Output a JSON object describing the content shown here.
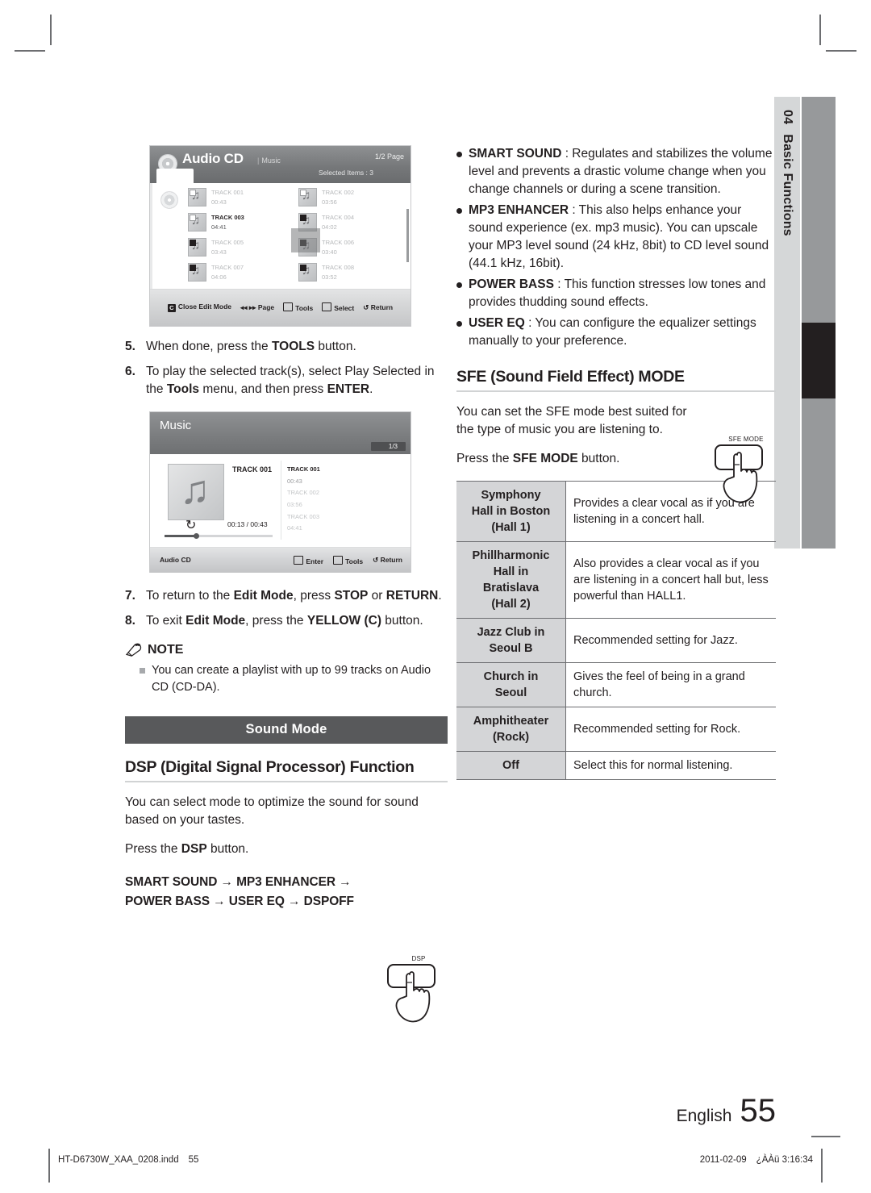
{
  "side_tab": {
    "chapter_number": "04",
    "chapter_title": "Basic Functions"
  },
  "screenshot_audio_cd": {
    "title": "Audio CD",
    "subtitle": "Music",
    "page_indicator": "1/2 Page",
    "selected_items": "Selected Items : 3",
    "tracks": [
      {
        "name": "TRACK 001",
        "time": "00:43",
        "checked": false,
        "active": false
      },
      {
        "name": "TRACK 002",
        "time": "03:56",
        "checked": false,
        "active": false
      },
      {
        "name": "TRACK 003",
        "time": "04:41",
        "checked": false,
        "active": true
      },
      {
        "name": "TRACK 004",
        "time": "04:02",
        "checked": true,
        "active": false
      },
      {
        "name": "TRACK 005",
        "time": "03:43",
        "checked": true,
        "active": false
      },
      {
        "name": "TRACK 006",
        "time": "03:40",
        "checked": true,
        "active": false
      },
      {
        "name": "TRACK 007",
        "time": "04:06",
        "checked": true,
        "active": false
      },
      {
        "name": "TRACK 008",
        "time": "03:52",
        "checked": true,
        "active": false
      }
    ],
    "footer": {
      "close_edit_mode": "Close Edit Mode",
      "close_key": "C",
      "page": "Page",
      "page_arrows": "◂◂ ▸▸",
      "tools": "Tools",
      "select": "Select",
      "return": "Return",
      "return_arrow": "↺"
    }
  },
  "screenshot_music": {
    "title": "Music",
    "page_indicator": "1/3",
    "now_playing": "TRACK 001",
    "playlist": [
      {
        "name": "TRACK 001",
        "time": "00:43"
      },
      {
        "name": "TRACK 002",
        "time": "03:56"
      },
      {
        "name": "TRACK 003",
        "time": "04:41"
      }
    ],
    "elapsed_total": "00:13 / 00:43",
    "repeat_icon": "↻",
    "source": "Audio CD",
    "footer": {
      "enter": "Enter",
      "tools": "Tools",
      "return": "Return",
      "return_arrow": "↺"
    }
  },
  "left_column": {
    "steps": [
      {
        "num": "5.",
        "segments": [
          {
            "t": "When done, press the ",
            "b": false
          },
          {
            "t": "TOOLS",
            "b": true
          },
          {
            "t": " button.",
            "b": false
          }
        ]
      },
      {
        "num": "6.",
        "segments": [
          {
            "t": "To play the selected track(s), select Play Selected in the ",
            "b": false
          },
          {
            "t": "Tools",
            "b": true
          },
          {
            "t": " menu, and then press ",
            "b": false
          },
          {
            "t": "ENTER",
            "b": true
          },
          {
            "t": ".",
            "b": false
          }
        ]
      }
    ],
    "steps_after": [
      {
        "num": "7.",
        "segments": [
          {
            "t": "To return to the ",
            "b": false
          },
          {
            "t": "Edit Mode",
            "b": true
          },
          {
            "t": ", press ",
            "b": false
          },
          {
            "t": "STOP",
            "b": true
          },
          {
            "t": " or ",
            "b": false
          },
          {
            "t": "RETURN",
            "b": true
          },
          {
            "t": ".",
            "b": false
          }
        ]
      },
      {
        "num": "8.",
        "segments": [
          {
            "t": "To exit ",
            "b": false
          },
          {
            "t": "Edit Mode",
            "b": true
          },
          {
            "t": ", press the ",
            "b": false
          },
          {
            "t": "YELLOW (C)",
            "b": true
          },
          {
            "t": " button.",
            "b": false
          }
        ]
      }
    ],
    "note_label": "NOTE",
    "notes": [
      "You can create a playlist with up to 99 tracks on Audio CD (CD-DA)."
    ],
    "section_band": "Sound Mode",
    "dsp_heading": "DSP (Digital Signal Processor) Function",
    "dsp_para": "You can select mode to optimize the sound for sound based on your tastes.",
    "dsp_press_segments": [
      {
        "t": "Press the ",
        "b": false
      },
      {
        "t": "DSP",
        "b": true
      },
      {
        "t": " button.",
        "b": false
      }
    ],
    "dsp_flow_line1": "SMART SOUND → MP3 ENHANCER →",
    "dsp_flow_line2": "POWER BASS →  USER EQ → DSPOFF",
    "dsp_button_label": "DSP"
  },
  "right_column": {
    "bullets": [
      {
        "term": "SMART SOUND",
        "desc": " : Regulates and stabilizes the volume level and prevents a drastic volume change when you change channels or during a scene transition."
      },
      {
        "term": "MP3 ENHANCER",
        "desc": " : This also helps enhance your sound experience (ex. mp3 music). You can upscale your MP3 level sound (24 kHz, 8bit) to CD level sound (44.1 kHz, 16bit)."
      },
      {
        "term": "POWER BASS",
        "desc": " : This function stresses low tones and provides thudding sound effects."
      },
      {
        "term": "USER EQ",
        "desc": " : You can configure the equalizer settings manually to your preference."
      }
    ],
    "sfe_heading": "SFE (Sound Field Effect) MODE",
    "sfe_para": "You can set the SFE mode best suited for the type of music you are listening to.",
    "sfe_press_segments": [
      {
        "t": "Press the ",
        "b": false
      },
      {
        "t": "SFE MODE",
        "b": true
      },
      {
        "t": " button.",
        "b": false
      }
    ],
    "sfe_button_label": "SFE MODE",
    "sfe_table": [
      {
        "mode": "Symphony\nHall in Boston\n(Hall 1)",
        "desc": "Provides a clear vocal as if you are listening in a concert hall."
      },
      {
        "mode": "Phillharmonic\nHall in\nBratislava\n(Hall 2)",
        "desc": "Also provides a clear vocal as if you are listening in a concert hall but, less powerful than HALL1."
      },
      {
        "mode": "Jazz Club in\nSeoul B",
        "desc": "Recommended setting for Jazz."
      },
      {
        "mode": "Church in\nSeoul",
        "desc": "Gives the feel of being in a grand church."
      },
      {
        "mode": "Amphitheater\n(Rock)",
        "desc": "Recommended setting for Rock."
      },
      {
        "mode": "Off",
        "desc": "Select this for normal listening."
      }
    ]
  },
  "footer": {
    "language": "English",
    "page_number": "55",
    "file_name": "HT-D6730W_XAA_0208.indd",
    "file_page": "55",
    "print_date": "2011-02-09",
    "print_time": "¿ÀÀü 3:16:34"
  }
}
